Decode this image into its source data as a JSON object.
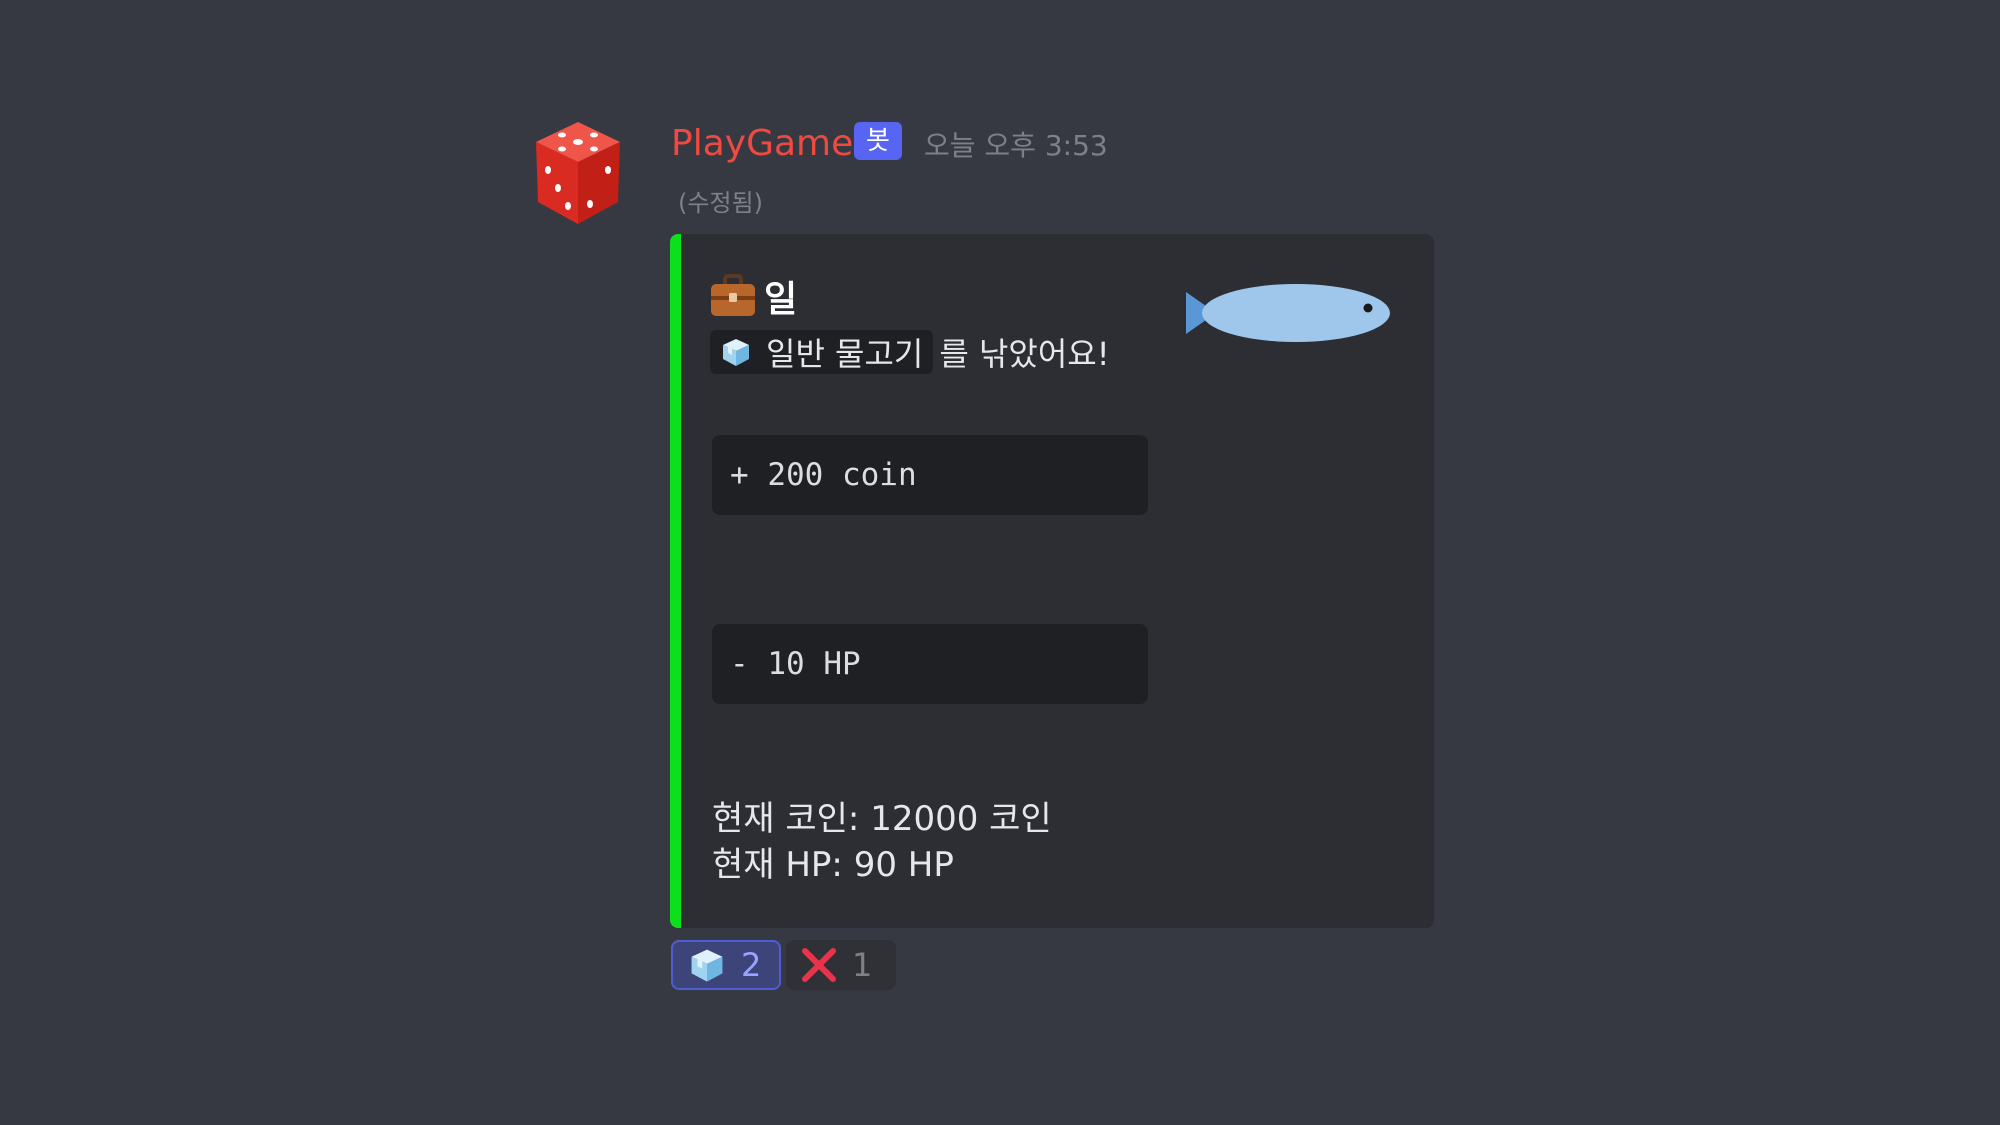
{
  "message": {
    "author": "PlayGame",
    "bot_tag": "봇",
    "timestamp": "오늘 오후 3:53",
    "edited": "(수정됨)",
    "author_color": "#f04a40"
  },
  "embed": {
    "accent_color": "#0ce01c",
    "title_icon": "briefcase-icon",
    "title": "일",
    "caught_icon": "ice-cube-icon",
    "caught_fish": "일반  물고기",
    "caught_suffix": "를 낚았어요!",
    "code_coin": "+ 200 coin",
    "code_hp": "- 10 HP",
    "status_coin": "현재 코인: 12000 코인",
    "status_hp": "현재 HP: 90 HP",
    "thumbnail_icon": "fish-icon"
  },
  "reactions": [
    {
      "icon": "ice-cube-icon",
      "count": "2",
      "active": true
    },
    {
      "icon": "cross-mark-icon",
      "count": "1",
      "active": false
    }
  ]
}
